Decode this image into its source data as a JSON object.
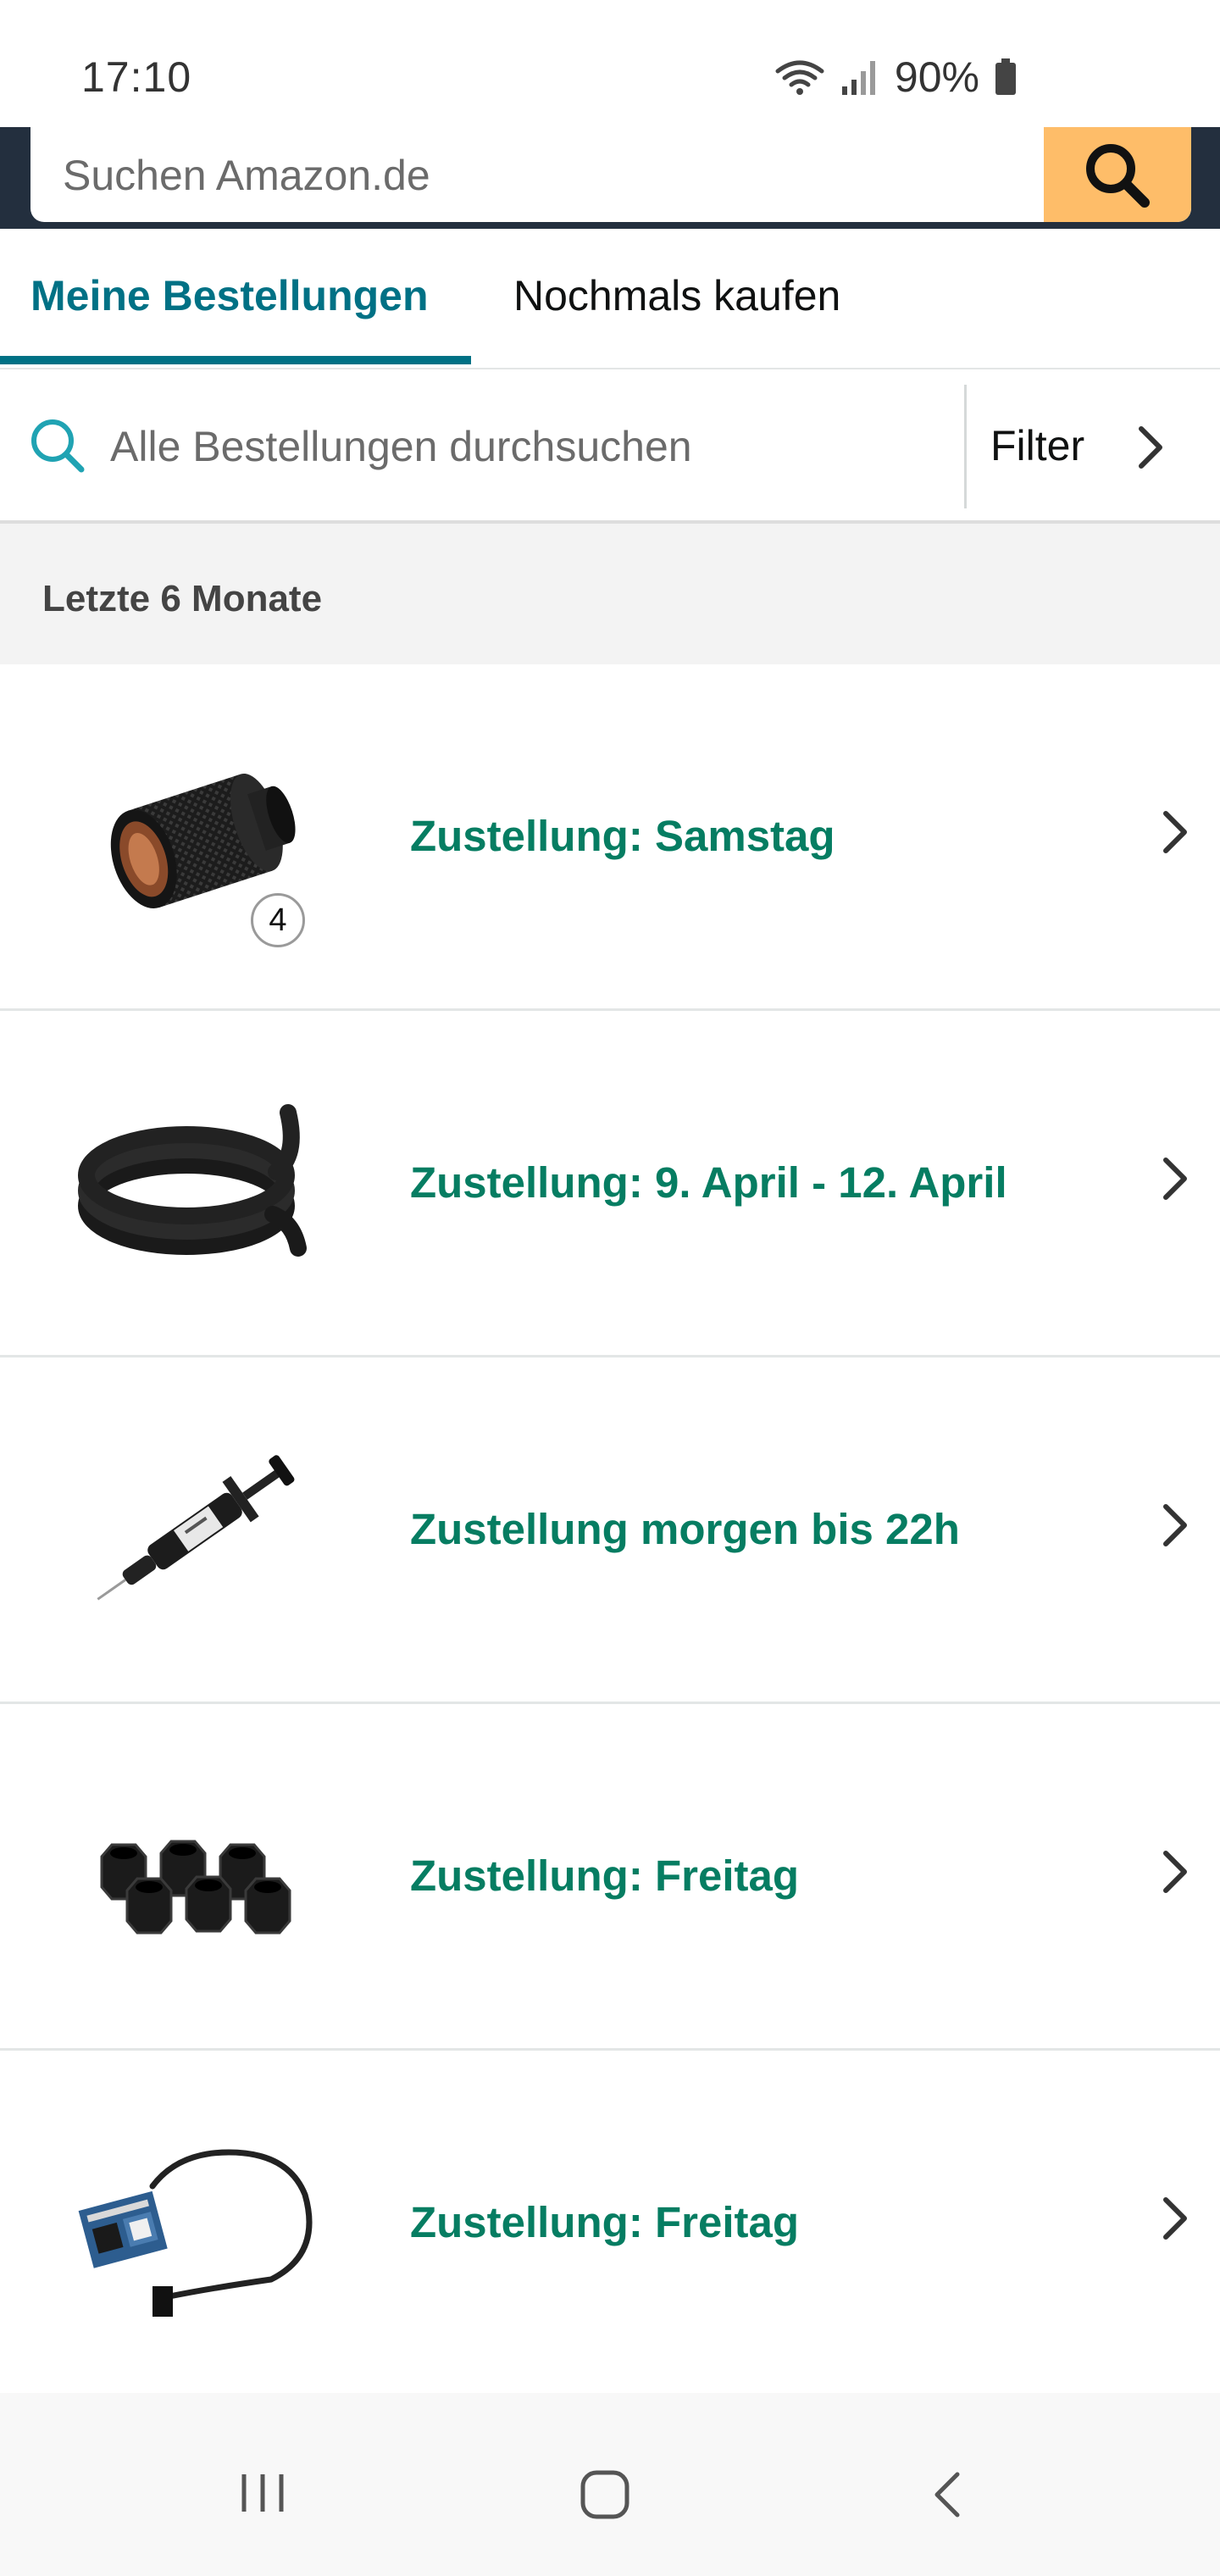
{
  "status_bar": {
    "time": "17:10",
    "battery": "90%",
    "icons": [
      "wifi-icon",
      "signal-icon",
      "battery-icon"
    ]
  },
  "search": {
    "placeholder": "Suchen Amazon.de",
    "button_icon": "search-icon"
  },
  "tabs": [
    {
      "label": "Meine Bestellungen",
      "active": true
    },
    {
      "label": "Nochmals kaufen",
      "active": false
    }
  ],
  "order_search": {
    "placeholder": "Alle Bestellungen durchsuchen",
    "filter_label": "Filter"
  },
  "section": {
    "title": "Letzte 6 Monate"
  },
  "orders": [
    {
      "status": "Zustellung: Samstag",
      "image": "fitting-extension-icon",
      "quantity": "4"
    },
    {
      "status": "Zustellung: 9. April - 12. April",
      "image": "tube-coil-icon"
    },
    {
      "status": "Zustellung morgen bis 22h",
      "image": "syringe-icon"
    },
    {
      "status": "Zustellung: Freitag",
      "image": "fittings-set-icon"
    },
    {
      "status": "Zustellung: Freitag",
      "image": "cable-adapter-icon"
    }
  ],
  "colors": {
    "header_bg": "#232f3e",
    "search_button": "#febd69",
    "tab_active": "#007185",
    "status_green": "#067d62"
  },
  "nav_bar": {
    "icons": [
      "recent-apps-icon",
      "home-icon",
      "back-icon"
    ]
  }
}
